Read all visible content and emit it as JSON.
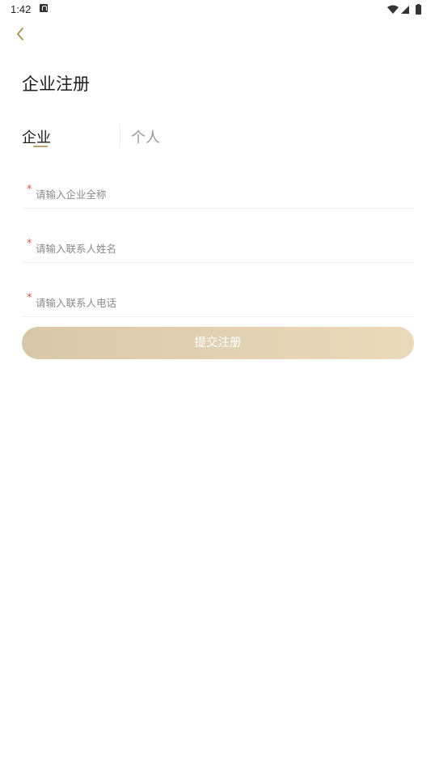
{
  "status_bar": {
    "time": "1:42",
    "icons": [
      "notification-a-icon",
      "wifi-icon",
      "signal-icon",
      "battery-icon"
    ]
  },
  "header": {
    "back_icon": "chevron-left-icon",
    "title": "企业注册"
  },
  "tabs": [
    {
      "label": "企业",
      "active": true
    },
    {
      "label": "个人",
      "active": false
    }
  ],
  "form": {
    "required_mark": "*",
    "fields": [
      {
        "placeholder": "请输入企业全称",
        "value": ""
      },
      {
        "placeholder": "请输入联系人姓名",
        "value": ""
      },
      {
        "placeholder": "请输入联系人电话",
        "value": ""
      }
    ],
    "submit_label": "提交注册"
  },
  "colors": {
    "accent": "#b8a06a",
    "button_gradient_start": "#d7c8aa",
    "button_gradient_end": "#e9dbba",
    "required": "#e0584a"
  }
}
